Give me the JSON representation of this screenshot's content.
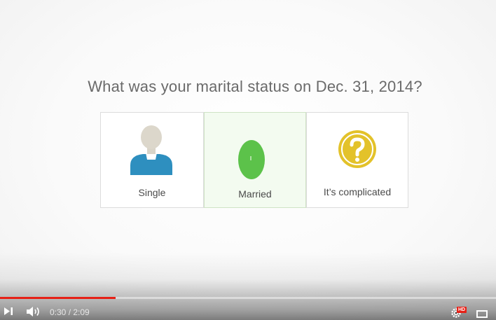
{
  "question": "What was your marital status on Dec. 31, 2014?",
  "options": [
    {
      "label": "Single",
      "icon": "person-icon"
    },
    {
      "label": "Married",
      "icon": "rings-icon",
      "selected": true
    },
    {
      "label": "It’s complicated",
      "icon": "question-mark-icon"
    }
  ],
  "player": {
    "current_time": "0:30",
    "duration": "2:09",
    "time_display": "0:30 / 2:09",
    "progress_fraction": 0.2326,
    "hd_badge": "HD",
    "colors": {
      "progress": "#e62117",
      "married_green": "#5cc24a",
      "single_shirt": "#2e8fbf",
      "complicated_gold": "#e3c22a"
    }
  }
}
